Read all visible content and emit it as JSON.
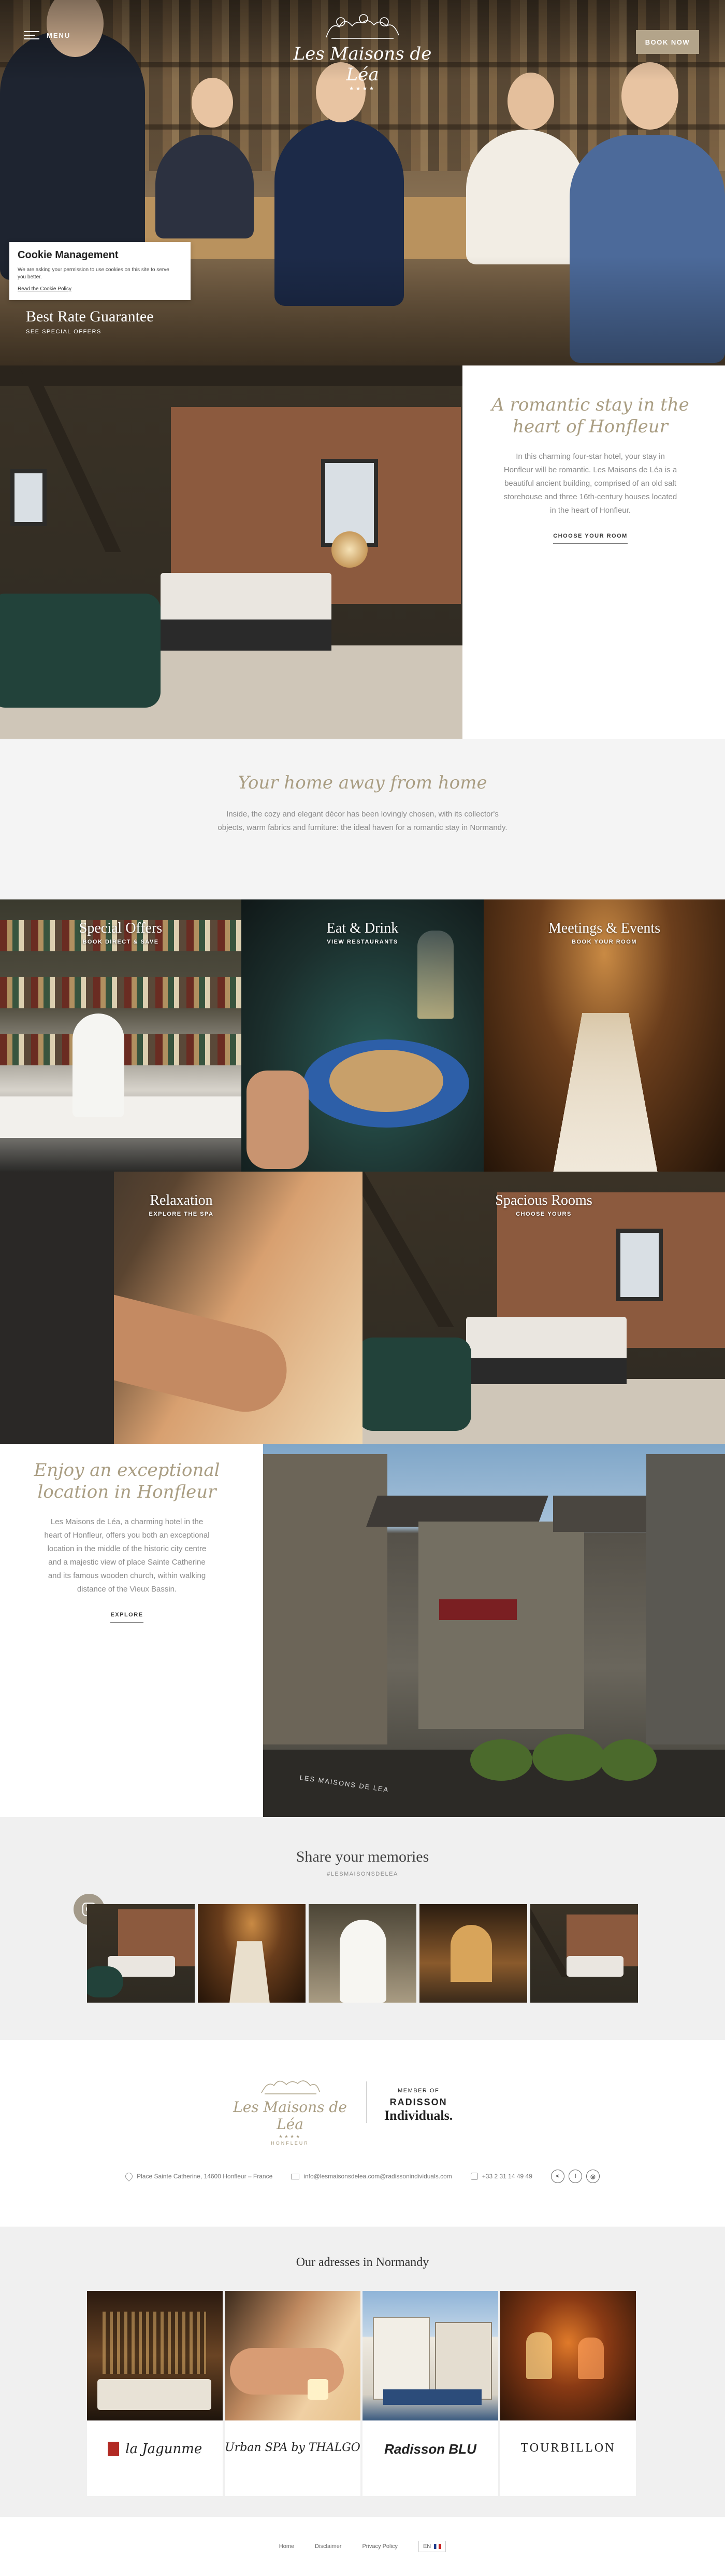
{
  "header": {
    "menu_label": "MENU",
    "logo_name": "Les Maisons de Léa",
    "logo_stars": "★★★★",
    "book_label": "BOOK NOW"
  },
  "cookie": {
    "title": "Cookie Management",
    "text": "We are asking your permission to use cookies on this site to serve you better.",
    "link": "Read the Cookie Policy"
  },
  "hero": {
    "title": "Best Rate Guarantee",
    "subtitle": "SEE SPECIAL OFFERS"
  },
  "romantic": {
    "heading": "A romantic stay in the heart of Honfleur",
    "text": "In this charming four-star hotel, your stay in Honfleur will be romantic. Les Maisons de Léa is a beautiful ancient building, comprised of an old salt storehouse and three 16th-century houses located in the heart of Honfleur.",
    "cta": "CHOOSE YOUR ROOM"
  },
  "home": {
    "heading": "Your home away from home",
    "text": "Inside, the cozy and elegant décor has been lovingly chosen, with its collector's objects, warm fabrics and furniture: the ideal haven for a romantic stay in Normandy."
  },
  "tiles": {
    "offers": {
      "title": "Special Offers",
      "sub": "BOOK DIRECT & SAVE"
    },
    "eat": {
      "title": "Eat & Drink",
      "sub": "VIEW RESTAURANTS"
    },
    "meetings": {
      "title": "Meetings & Events",
      "sub": "BOOK YOUR ROOM"
    },
    "relax": {
      "title": "Relaxation",
      "sub": "EXPLORE THE SPA"
    },
    "rooms": {
      "title": "Spacious Rooms",
      "sub": "CHOOSE YOURS"
    }
  },
  "honfleur": {
    "heading": "Enjoy an exceptional location in Honfleur",
    "text": "Les Maisons de Léa, a charming hotel in the heart of Honfleur, offers you both an exceptional location in the middle of the historic city centre and a majestic view of place Sainte Catherine and its famous wooden church, within walking distance of the Vieux Bassin.",
    "cta": "EXPLORE",
    "sign": "LES MAISONS DE LEA"
  },
  "share": {
    "heading": "Share your memories",
    "hashtag": "#LESMAISONSDELEA"
  },
  "brand": {
    "logo_name": "Les Maisons de Léa",
    "logo_stars": "★★★★",
    "logo_sub": "HONFLEUR",
    "member": "MEMBER OF",
    "radisson": "RADISSON",
    "individuals": "Individuals."
  },
  "contact": {
    "address": "Place Sainte Catherine, 14600 Honfleur – France",
    "email": "info@lesmaisonsdelea.com@radissonindividuals.com",
    "phone": "+33 2 31 14 49 49",
    "social_share": "<",
    "social_facebook": "f",
    "social_instagram": "◎"
  },
  "addresses": {
    "heading": "Our adresses in Normandy",
    "cards": [
      {
        "brand": "la Jagunme"
      },
      {
        "brand": "Urban SPA by THALGO"
      },
      {
        "brand": "Radisson BLU"
      },
      {
        "brand": "TOURBILLON"
      }
    ]
  },
  "footer": {
    "home": "Home",
    "disclaimer": "Disclaimer",
    "privacy": "Privacy Policy",
    "lang": "EN"
  },
  "colors": {
    "accent": "#a99d82",
    "button": "#b3a48a",
    "light_bg": "#f0f0f0"
  }
}
